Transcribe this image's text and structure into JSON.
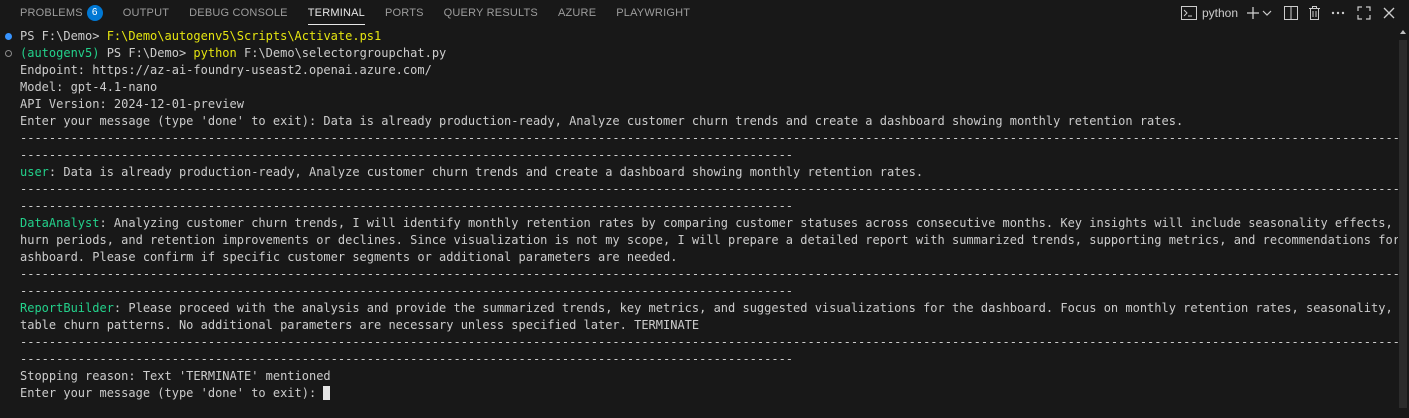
{
  "tabs": [
    {
      "label": "PROBLEMS",
      "badge": "6"
    },
    {
      "label": "OUTPUT"
    },
    {
      "label": "DEBUG CONSOLE"
    },
    {
      "label": "TERMINAL",
      "active": true
    },
    {
      "label": "PORTS"
    },
    {
      "label": "QUERY RESULTS"
    },
    {
      "label": "AZURE"
    },
    {
      "label": "PLAYWRIGHT"
    }
  ],
  "toolbar": {
    "terminal_name": "python",
    "icons": [
      "terminal-icon",
      "plus-icon",
      "chevron-down-icon",
      "split-icon",
      "trash-icon",
      "more-icon",
      "maximize-icon",
      "close-icon"
    ]
  },
  "terminal": {
    "line1_prompt": "PS F:\\Demo> ",
    "line1_cmd": "F:\\Demo\\autogenv5\\Scripts\\Activate.ps1",
    "line2_env": "(autogenv5)",
    "line2_prompt": " PS F:\\Demo> ",
    "line2_cmd": "python",
    "line2_arg": " F:\\Demo\\selectorgroupchat.py",
    "endpoint": "Endpoint: https://az-ai-foundry-useast2.openai.azure.com/",
    "model": "Model: gpt-4.1-nano",
    "api_version": "API Version: 2024-12-01-preview",
    "enter_msg": "Enter your message (type 'done' to exit): Data is already production-ready, Analyze customer churn trends and create a dashboard showing monthly retention rates.",
    "dash_full": "---------------------------------------------------------------------------------------------------------------------------------------------------------------------------------------------------------",
    "dash_short": "-----------------------------------------------------------------------------------------------------------",
    "user_label": "user",
    "user_msg": ": Data is already production-ready, Analyze customer churn trends and create a dashboard showing monthly retention rates.",
    "analyst_label": "DataAnalyst",
    "analyst_line1": ": Analyzing customer churn trends, I will identify monthly retention rates by comparing customer statuses across consecutive months. Key insights will include seasonality effects, high c",
    "analyst_line2": "hurn periods, and retention improvements or declines. Since visualization is not my scope, I will prepare a detailed report with summarized trends, supporting metrics, and recommendations for the d",
    "analyst_line3": "ashboard. Please confirm if specific customer segments or additional parameters are needed.",
    "builder_label": "ReportBuilder",
    "builder_line1": ": Please proceed with the analysis and provide the summarized trends, key metrics, and suggested visualizations for the dashboard. Focus on monthly retention rates, seasonality, and no",
    "builder_line2": "table churn patterns. No additional parameters are necessary unless specified later. TERMINATE",
    "stopping": "Stopping reason: Text 'TERMINATE' mentioned",
    "final_prompt": "Enter your message (type 'done' to exit): "
  }
}
